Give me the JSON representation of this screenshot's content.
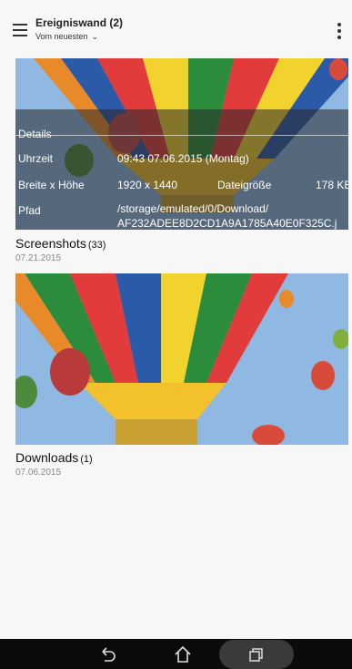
{
  "header": {
    "title": "Ereigniswand (2)",
    "sort_label": "Vom neuesten",
    "chevron": "⌄"
  },
  "albums": [
    {
      "name": "Screenshots",
      "count": "(33)",
      "date": "07.21.2015",
      "details": {
        "heading": "Details",
        "time_label": "Uhrzeit",
        "time_value": "09:43 07.06.2015 (Montag)",
        "size_label": "Breite x Höhe",
        "size_value": "1920 x 1440",
        "filesize_label": "Dateigröße",
        "filesize_value": "178 KB",
        "path_label": "Pfad",
        "path_line1": "/storage/emulated/0/Download/",
        "path_line2": "AF232ADEE8D2CD1A9A1785A40E0F325C.j"
      }
    },
    {
      "name": "Downloads",
      "count": "(1)",
      "date": "07.06.2015"
    }
  ],
  "navbar": {
    "back_icon": "back-icon",
    "home_icon": "home-icon",
    "recents_icon": "recent-apps-icon"
  },
  "colors": {
    "background": "#f7f7f7",
    "sky": "#8fb9e3",
    "navbar": "#0b0b0b"
  }
}
